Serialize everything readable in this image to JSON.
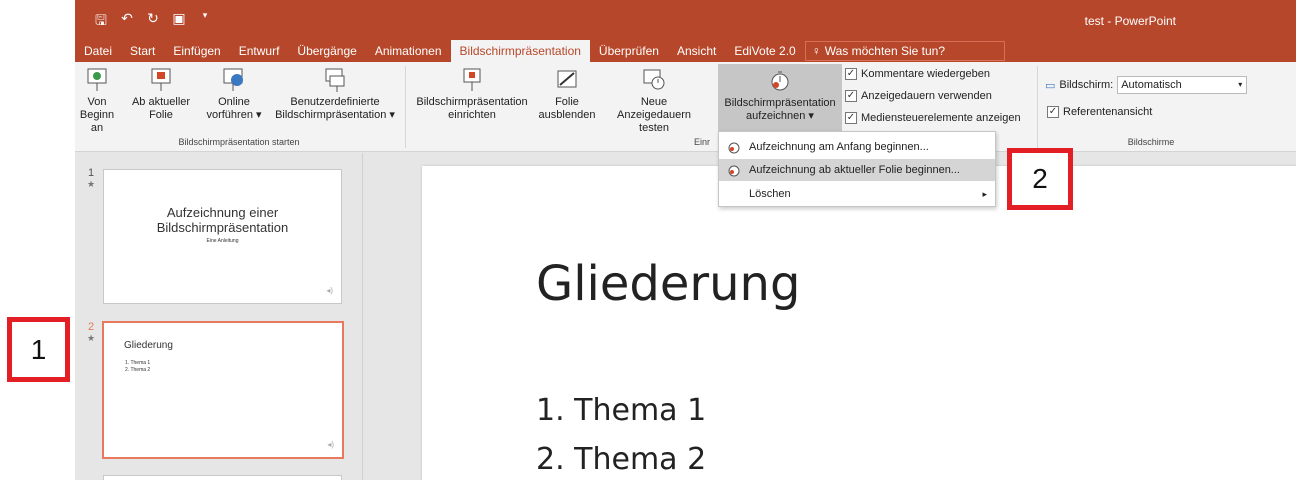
{
  "titlebar": {
    "title": "test - PowerPoint",
    "qat_icons": [
      "save-icon",
      "undo-icon",
      "redo-icon",
      "present-icon"
    ]
  },
  "tabs": [
    "Datei",
    "Start",
    "Einfügen",
    "Entwurf",
    "Übergänge",
    "Animationen",
    "Bildschirmpräsentation",
    "Überprüfen",
    "Ansicht",
    "EdiVote 2.0"
  ],
  "active_tab": "Bildschirmpräsentation",
  "tellme": "Was möchten Sie tun?",
  "ribbon": {
    "from_start": [
      "Von",
      "Beginn an"
    ],
    "from_current": [
      "Ab aktueller",
      "Folie"
    ],
    "online": [
      "Online",
      "vorführen ▾"
    ],
    "custom": [
      "Benutzerdefinierte",
      "Bildschirmpräsentation ▾"
    ],
    "group1": "Bildschirmpräsentation starten",
    "setup": [
      "Bildschirmpräsentation",
      "einrichten"
    ],
    "hide": [
      "Folie",
      "ausblenden"
    ],
    "rehearse": [
      "Neue Anzeigedauern",
      "testen"
    ],
    "record": [
      "Bildschirmpräsentation",
      "aufzeichnen ▾"
    ],
    "group2": "Einr",
    "checkboxes": [
      "Kommentare wiedergeben",
      "Anzeigedauern verwenden",
      "Mediensteuerelemente anzeigen"
    ],
    "monitor_label": "Bildschirm:",
    "monitor_value": "Automatisch",
    "presenter_view": "Referentenansicht",
    "group3": "Bildschirme"
  },
  "menu": {
    "items": [
      "Aufzeichnung am Anfang beginnen...",
      "Aufzeichnung ab aktueller Folie beginnen...",
      "Löschen"
    ]
  },
  "thumbnails": [
    {
      "num": "1",
      "title_line1": "Aufzeichnung einer",
      "title_line2": "Bildschirmpräsentation",
      "subtitle": "Eine Anleitung"
    },
    {
      "num": "2",
      "title": "Gliederung",
      "items": [
        "1.  Thema 1",
        "2.  Thema 2"
      ]
    }
  ],
  "slide": {
    "title": "Gliederung",
    "items": [
      "1.  Thema 1",
      "2.  Thema 2"
    ]
  },
  "callouts": {
    "one": "1",
    "two": "2"
  },
  "colors": {
    "accent": "#b7472a",
    "callout": "#e31e24",
    "selected_thumb": "#e8795f"
  }
}
